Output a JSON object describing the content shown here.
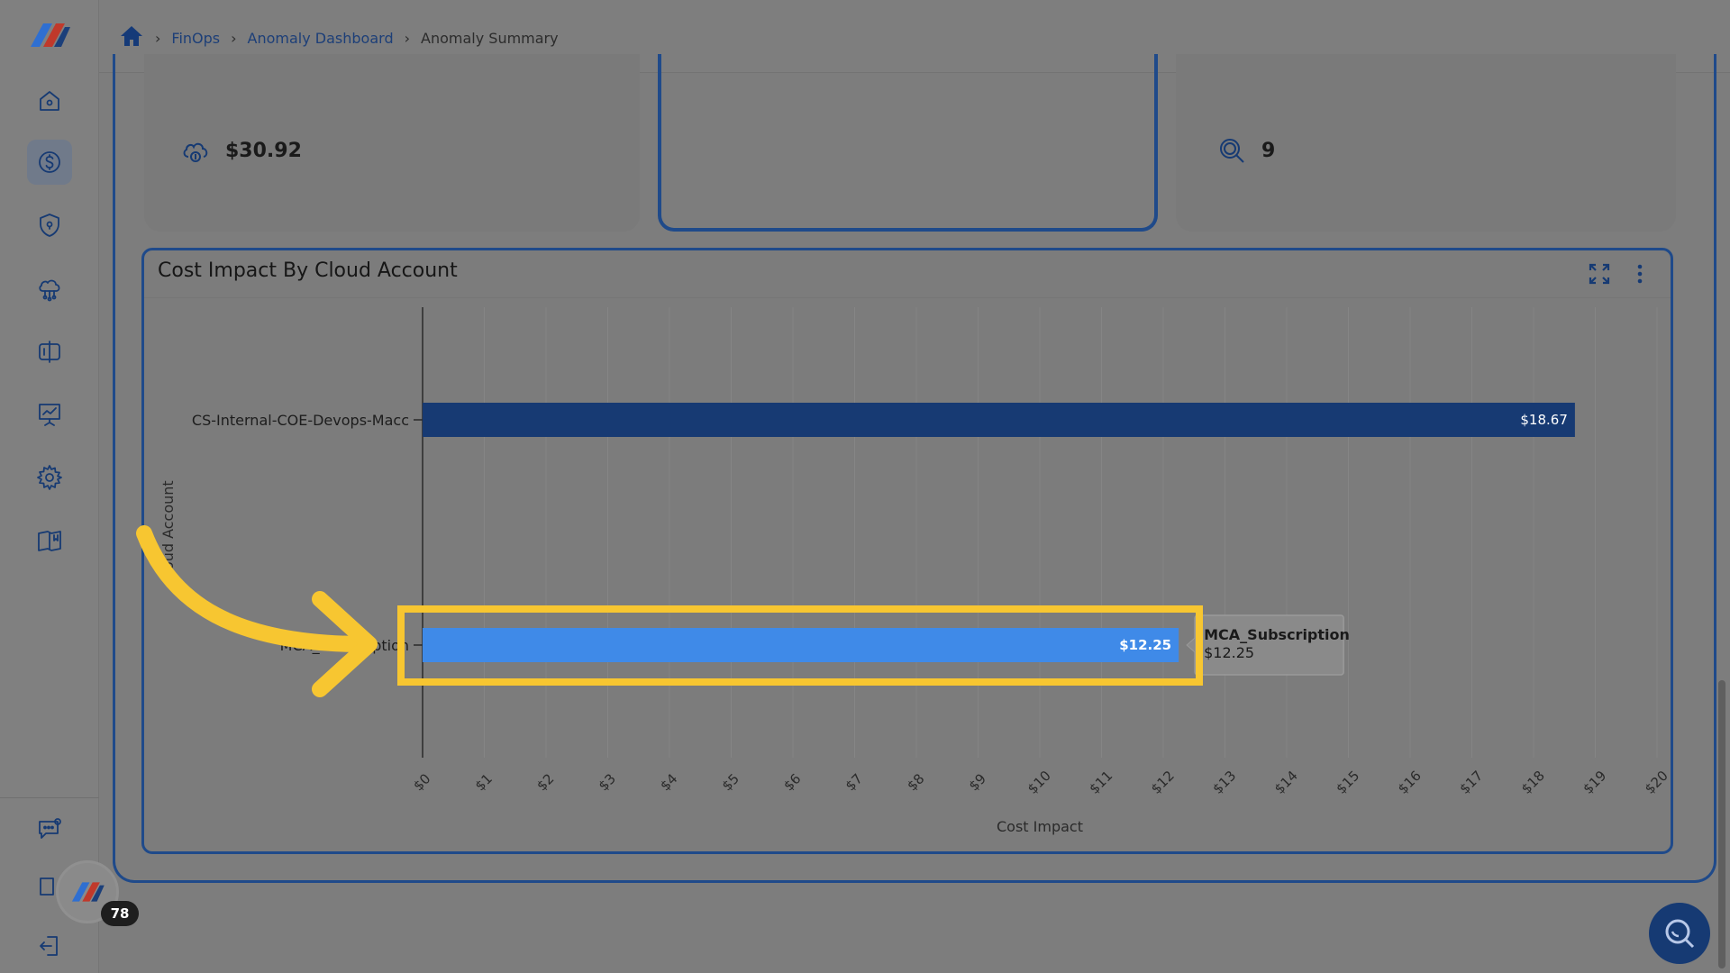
{
  "breadcrumb": {
    "home_icon": "home-icon",
    "items": [
      "FinOps",
      "Anomaly Dashboard",
      "Anomaly Summary"
    ]
  },
  "sidebar": {
    "icons": [
      "home-icon",
      "dollar-icon",
      "shield-icon",
      "cloud-network-icon",
      "compare-icon",
      "presentation-icon",
      "gear-icon",
      "book-icon",
      "chat-icon",
      "support-icon",
      "logout-icon"
    ],
    "active": "dollar-icon",
    "notification_count": "78"
  },
  "metrics": {
    "card1_value": "$30.92",
    "card3_value": "9"
  },
  "chart": {
    "title": "Cost Impact By Cloud Account",
    "tooltip_name": "MCA_Subscription",
    "tooltip_value": "$12.25"
  },
  "chart_data": {
    "type": "bar",
    "orientation": "horizontal",
    "title": "Cost Impact By Cloud Account",
    "xlabel": "Cost Impact",
    "ylabel": "Cloud Account",
    "xlim": [
      0,
      20
    ],
    "x_ticks": [
      "$0",
      "$1",
      "$2",
      "$3",
      "$4",
      "$5",
      "$6",
      "$7",
      "$8",
      "$9",
      "$10",
      "$11",
      "$12",
      "$13",
      "$14",
      "$15",
      "$16",
      "$17",
      "$18",
      "$19",
      "$20"
    ],
    "categories": [
      "CS-Internal-COE-Devops-Macc",
      "MCA_Subscription"
    ],
    "values": [
      18.67,
      12.25
    ],
    "data_labels": [
      "$18.67",
      "$12.25"
    ],
    "bar_colors": [
      "#173a73",
      "#3f8ae8"
    ],
    "grid": true,
    "highlighted_category": "MCA_Subscription"
  },
  "colors": {
    "accent": "#1f4a8a",
    "highlight": "#f7c631",
    "bar_dark": "#173a73",
    "bar_light": "#3f8ae8"
  }
}
